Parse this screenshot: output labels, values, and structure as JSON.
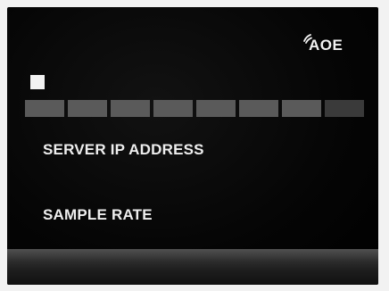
{
  "header": {
    "logo_text": "AOE",
    "logo_icon": "wireless-waves-icon"
  },
  "status": {
    "indicator_icon": "square-indicator-icon"
  },
  "progress": {
    "total_segments": 8,
    "filled_segments": 7,
    "filled_color": "#5a5a5a",
    "empty_color": "#3a3a3a"
  },
  "menu": {
    "items": [
      {
        "label": "SERVER IP ADDRESS"
      },
      {
        "label": "SAMPLE RATE"
      }
    ]
  }
}
